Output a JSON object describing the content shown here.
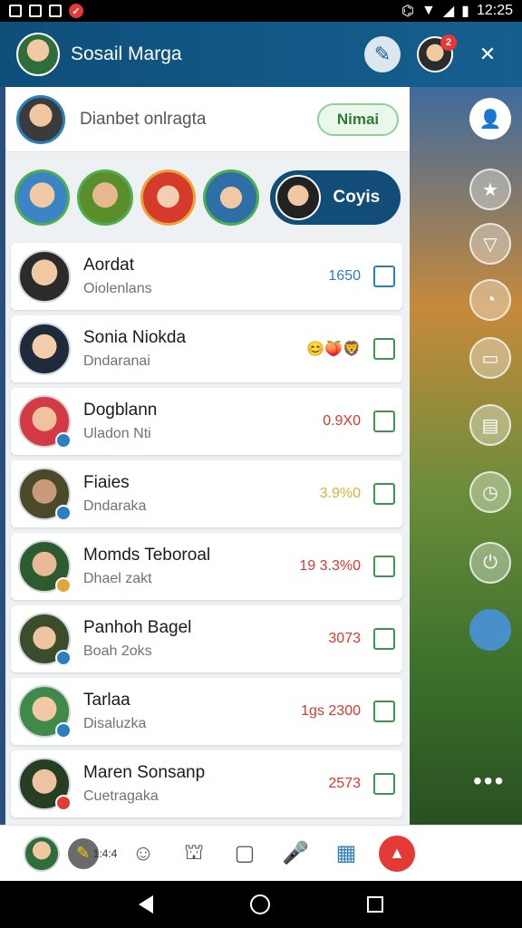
{
  "status_bar": {
    "time": "12:25",
    "icons": [
      "image-icon",
      "save-icon",
      "gallery-icon",
      "notification-icon",
      "bug-icon",
      "wifi-icon",
      "signal-icon",
      "battery-icon"
    ]
  },
  "header": {
    "title": "Sosail Marga",
    "notification_count": "2",
    "actions": [
      "pin-icon",
      "profile-avatar",
      "close-icon"
    ]
  },
  "search": {
    "placeholder": "Dianbet onlragta",
    "button_label": "Nimai"
  },
  "stories": {
    "pill_label": "Coyis"
  },
  "contacts": [
    {
      "name": "Aordat",
      "subtitle": "Oiolenlans",
      "meta": "1650",
      "meta_icon": "fire-icon",
      "meta_color": "blue"
    },
    {
      "name": "Sonia Niokda",
      "subtitle": "Dndaranai",
      "meta": "",
      "meta_icon": "emoji-reactions-icon",
      "meta_color": "orange"
    },
    {
      "name": "Dogblann",
      "subtitle": "Uladon Nti",
      "meta": "0.9X0",
      "meta_icon": "",
      "meta_color": "red"
    },
    {
      "name": "Fiaies",
      "subtitle": "Dndaraka",
      "meta": "3.9%0",
      "meta_icon": "star-icon",
      "meta_color": "yellow"
    },
    {
      "name": "Momds Teboroal",
      "subtitle": "Dhael zakt",
      "meta": "19  3.3%0",
      "meta_icon": "",
      "meta_color": "red"
    },
    {
      "name": "Panhoh Bagel",
      "subtitle": "Boah 2oks",
      "meta": "3073",
      "meta_icon": "trophy-icon",
      "meta_color": "red"
    },
    {
      "name": "Tarlaa",
      "subtitle": "Disaluzka",
      "meta": "1gs  2300",
      "meta_icon": "",
      "meta_color": "red"
    },
    {
      "name": "Maren Sonsanp",
      "subtitle": "Cuetragaka",
      "meta": "2573",
      "meta_icon": "trophy-icon",
      "meta_color": "red"
    }
  ],
  "bottom_nav": {
    "items": [
      "profile-avatar",
      "pencil-icon",
      "smile-icon",
      "people-icon",
      "chat-icon",
      "microphone-icon",
      "clipboard-icon",
      "red-alert-icon"
    ],
    "small_text": "1:4:4"
  },
  "sidebar_icons": [
    "user-icon",
    "star-icon",
    "filter-icon",
    "chat-bubble-icon",
    "card-icon",
    "tv-icon",
    "timer-icon",
    "power-icon",
    "blue-orb-icon",
    "more-icon"
  ]
}
